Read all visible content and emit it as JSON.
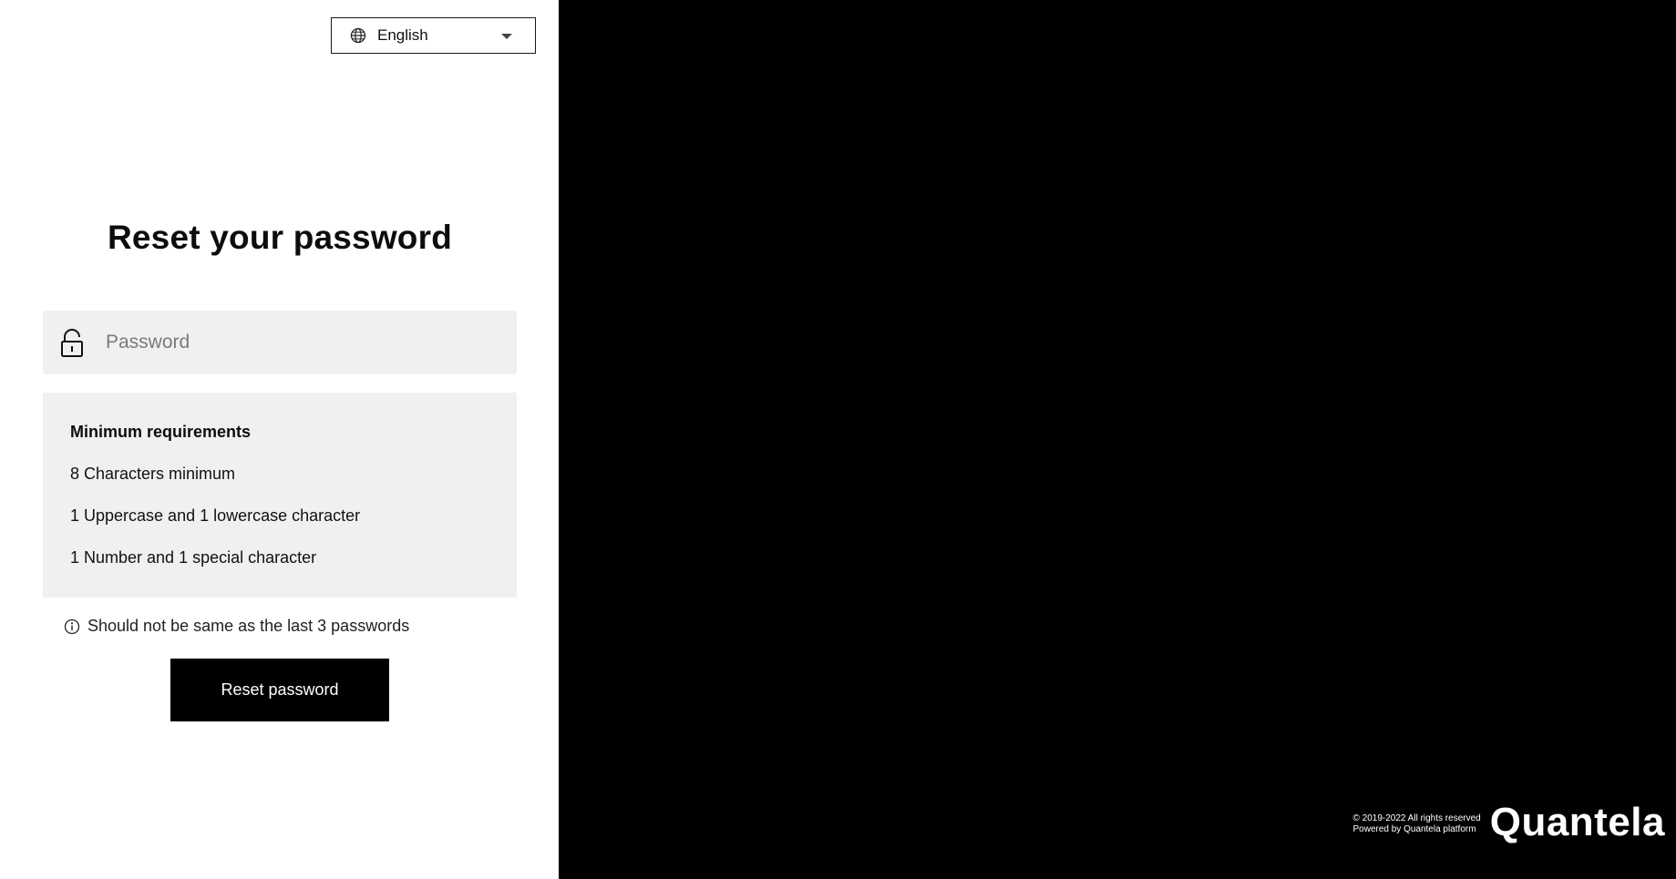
{
  "language_selector": {
    "selected": "English",
    "globe_icon": "globe-icon",
    "caret_icon": "chevron-down-icon"
  },
  "form": {
    "title": "Reset your password",
    "password_placeholder": "Password",
    "lock_icon": "lock-icon"
  },
  "requirements": {
    "heading": "Minimum requirements",
    "items": [
      "8 Characters minimum",
      "1 Uppercase and 1 lowercase character",
      "1 Number and 1 special character"
    ]
  },
  "note": {
    "icon": "info-icon",
    "text": "Should not be same as the last 3 passwords"
  },
  "actions": {
    "reset_label": "Reset password"
  },
  "footer": {
    "copyright": "© 2019-2022 All rights reserved",
    "powered_by": "Powered by Quantela platform",
    "brand": "Quantela"
  },
  "colors": {
    "right_panel": "#000000",
    "field_background": "#f0f0f0",
    "button_background": "#000000"
  }
}
